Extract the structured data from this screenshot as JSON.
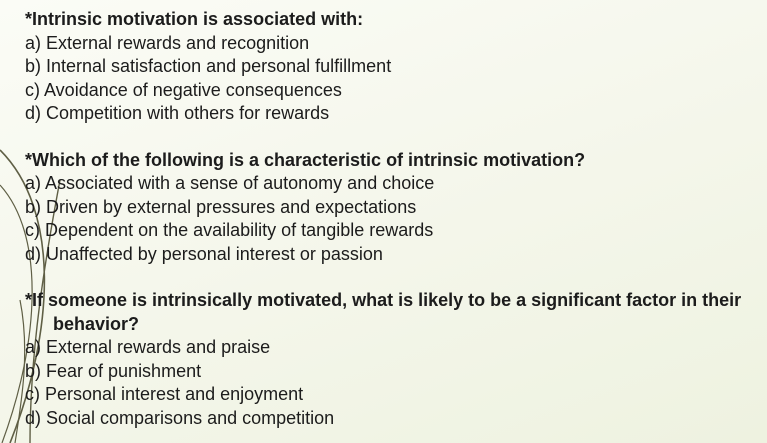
{
  "questions": [
    {
      "title": "*Intrinsic motivation is associated with:",
      "options": [
        "a) External rewards and recognition",
        "b) Internal satisfaction and personal fulfillment",
        "c) Avoidance of negative consequences",
        "d) Competition with others for rewards"
      ]
    },
    {
      "title": "*Which of the following is a characteristic of intrinsic motivation?",
      "options": [
        "a) Associated with a sense of autonomy and choice",
        "b) Driven by external pressures and expectations",
        "c) Dependent on the availability of tangible rewards",
        "d) Unaffected by personal interest or passion"
      ]
    },
    {
      "title": "*If someone is intrinsically motivated, what is likely to be a significant factor in their behavior?",
      "options": [
        "a) External rewards and praise",
        "b) Fear of punishment",
        "c) Personal interest and enjoyment",
        "d) Social comparisons and competition"
      ]
    }
  ],
  "colors": {
    "background": "#f4f6ea",
    "text": "#1c1c1c",
    "decor_lines": "#6b6b4e"
  }
}
